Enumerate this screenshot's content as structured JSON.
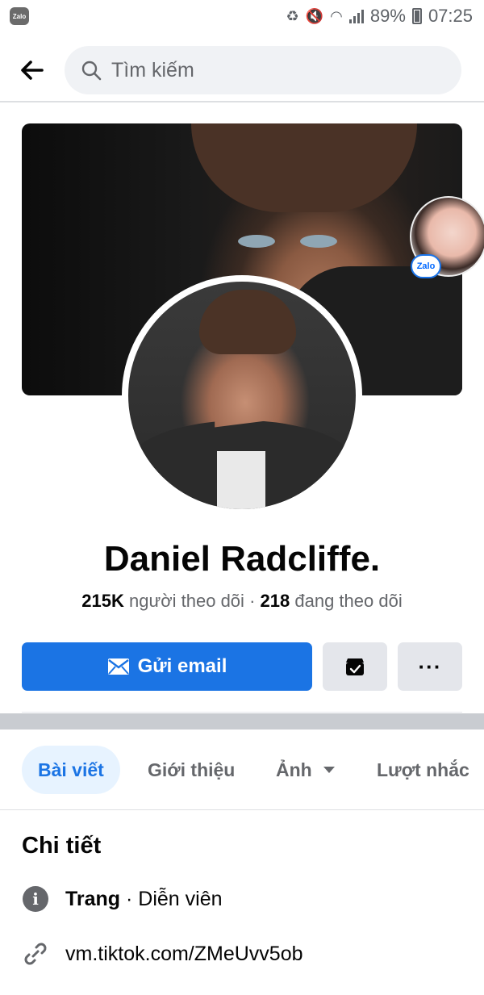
{
  "status_bar": {
    "app_icon_label": "Zalo",
    "battery": "89%",
    "time": "07:25"
  },
  "header": {
    "search_placeholder": "Tìm kiếm"
  },
  "zalo_bubble": {
    "label": "Zalo"
  },
  "profile": {
    "name": "Daniel Radcliffe.",
    "followers_count": "215K",
    "followers_label": "người theo dõi",
    "separator": "·",
    "following_count": "218",
    "following_label": "đang theo dõi"
  },
  "actions": {
    "email_label": "Gửi email",
    "more_label": "···"
  },
  "tabs": [
    {
      "label": "Bài viết",
      "active": true
    },
    {
      "label": "Giới thiệu",
      "active": false
    },
    {
      "label": "Ảnh",
      "active": false
    },
    {
      "label": "Lượt nhắc",
      "active": false
    }
  ],
  "details": {
    "title": "Chi tiết",
    "category_bold": "Trang",
    "category_rest": " · Diễn viên",
    "link": "vm.tiktok.com/ZMeUvv5ob"
  },
  "colors": {
    "primary": "#1b74e4",
    "secondary_button": "#e4e6eb",
    "active_tab_bg": "#e7f3ff",
    "muted_text": "#65676b"
  }
}
